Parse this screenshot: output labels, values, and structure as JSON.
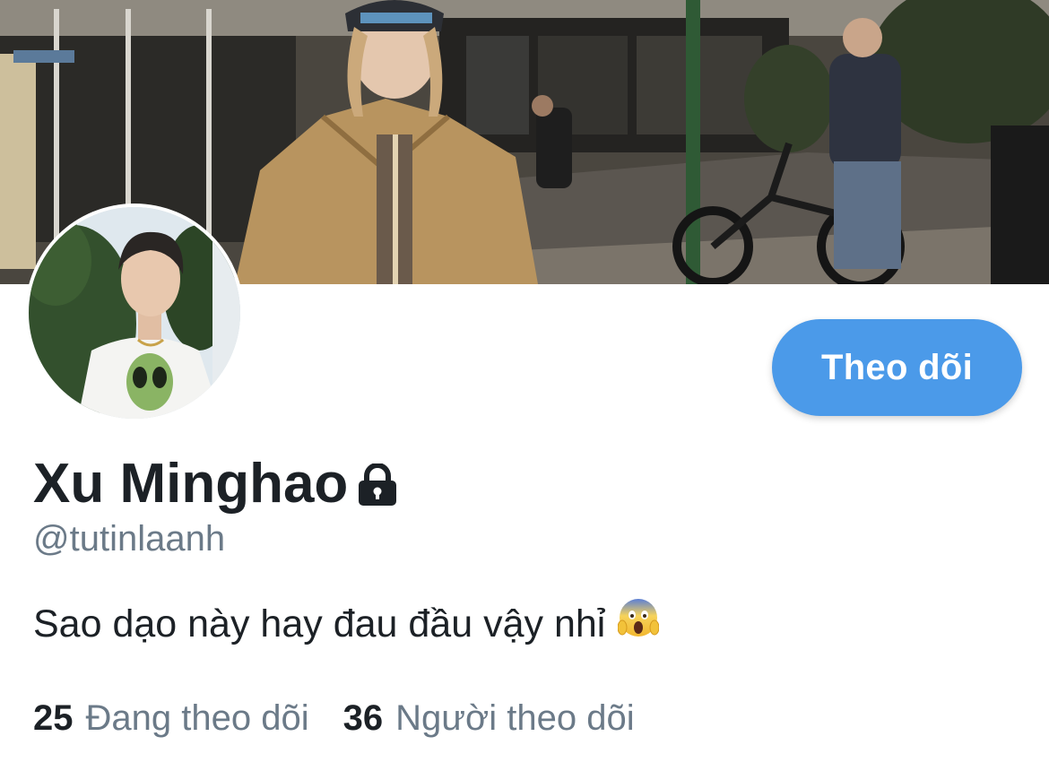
{
  "profile": {
    "display_name": "Xu Minghao",
    "handle": "@tutinlaanh",
    "bio": "Sao dạo này hay đau đầu vậy nhỉ",
    "bio_emoji": "face-screaming-in-fear-icon",
    "protected": true
  },
  "actions": {
    "follow_label": "Theo dõi"
  },
  "stats": {
    "following_count": "25",
    "following_label": "Đang theo dõi",
    "followers_count": "36",
    "followers_label": "Người theo dõi"
  },
  "images": {
    "banner": "street-photo-banner",
    "avatar": "profile-photo"
  },
  "colors": {
    "accent": "#4b9ae9",
    "text_primary": "#1c2126",
    "text_secondary": "#6b7a88",
    "background": "#ffffff"
  }
}
